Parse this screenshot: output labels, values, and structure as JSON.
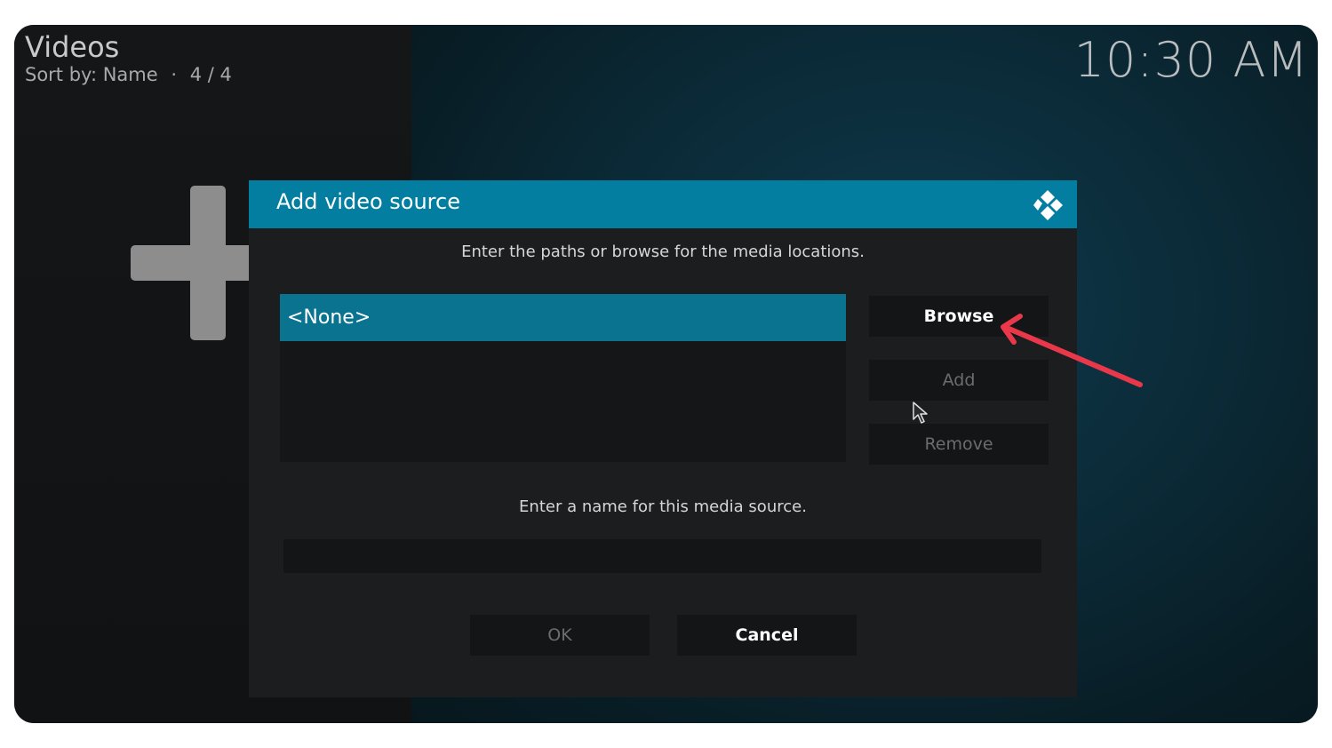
{
  "header": {
    "title": "Videos",
    "sort": "Sort by: Name",
    "separator": "·",
    "count": "4 / 4",
    "clock": "10:30 AM"
  },
  "background": {
    "add_icon": "plus-icon"
  },
  "dialog": {
    "title": "Add video source",
    "logo_icon": "kodi-logo-icon",
    "paths_prompt": "Enter the paths or browse for the media locations.",
    "paths": [
      "<None>"
    ],
    "buttons": {
      "browse": "Browse",
      "add": "Add",
      "remove": "Remove",
      "ok": "OK",
      "cancel": "Cancel"
    },
    "name_prompt": "Enter a name for this media source.",
    "name_value": ""
  },
  "annotation": {
    "arrow_color": "#e8384a"
  },
  "colors": {
    "accent": "#047ea0",
    "selected": "#0a7390"
  }
}
